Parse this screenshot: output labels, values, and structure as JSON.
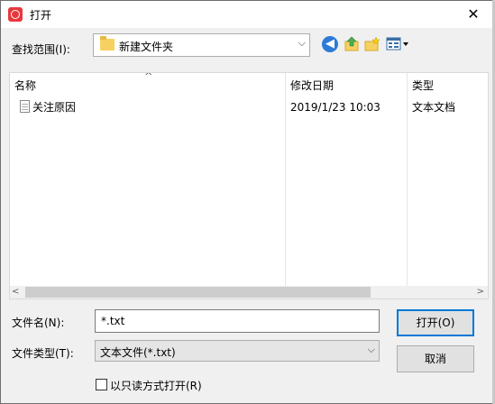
{
  "dialog": {
    "title": "打开",
    "close_glyph": "✕"
  },
  "lookin": {
    "label": "查找范围(I):",
    "value": "新建文件夹"
  },
  "toolbar": {
    "icons": [
      "back-icon",
      "up-folder-icon",
      "new-folder-icon",
      "view-menu-icon"
    ]
  },
  "filelist": {
    "columns": [
      "名称",
      "修改日期",
      "类型"
    ],
    "rows": [
      {
        "name": "关注原因",
        "modified": "2019/1/23 10:03",
        "type": "文本文档"
      }
    ]
  },
  "filename": {
    "label": "文件名(N):",
    "value": "*.txt"
  },
  "filetype": {
    "label": "文件类型(T):",
    "value": "文本文件(*.txt)"
  },
  "buttons": {
    "open": "打开(O)",
    "cancel": "取消"
  },
  "readonly": {
    "label": "以只读方式打开(R)",
    "checked": false
  }
}
